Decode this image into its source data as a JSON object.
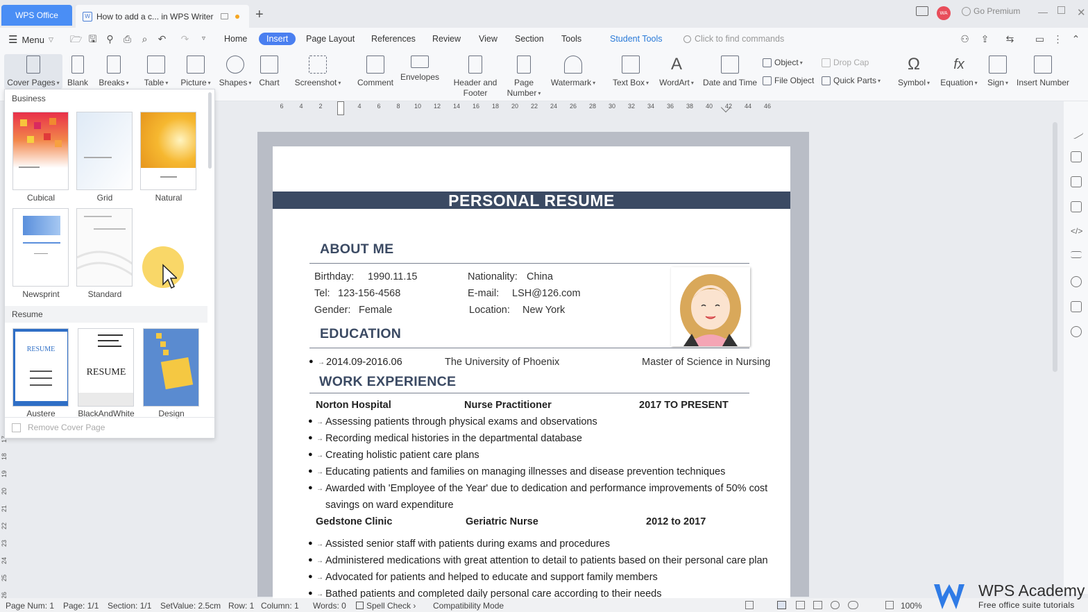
{
  "titlebar": {
    "app_tab": "WPS Office",
    "doc_tab": "How to add a c... in WPS Writer",
    "new_tab": "+",
    "go_premium": "Go Premium",
    "avatar_text": "WA"
  },
  "menubar": {
    "menu_label": "Menu",
    "tabs": [
      "Home",
      "Insert",
      "Page Layout",
      "References",
      "Review",
      "View",
      "Section",
      "Tools"
    ],
    "active_tab": "Insert",
    "student_tools": "Student Tools",
    "find_placeholder": "Click to find commands"
  },
  "ribbon": {
    "cover_pages": "Cover Pages",
    "blank": "Blank",
    "breaks": "Breaks",
    "table": "Table",
    "picture": "Picture",
    "shapes": "Shapes",
    "chart": "Chart",
    "screenshot": "Screenshot",
    "comment": "Comment",
    "envelopes": "Envelopes",
    "header_footer_1": "Header and",
    "header_footer_2": "Footer",
    "page_number_1": "Page",
    "page_number_2": "Number",
    "watermark": "Watermark",
    "text_box": "Text Box",
    "wordart": "WordArt",
    "date_time": "Date and Time",
    "object": "Object",
    "file_object": "File Object",
    "drop_cap": "Drop Cap",
    "quick_parts": "Quick Parts",
    "symbol": "Symbol",
    "equation": "Equation",
    "sign": "Sign",
    "insert_number": "Insert Number"
  },
  "ruler": {
    "ticks": [
      "6",
      "4",
      "2",
      "2",
      "4",
      "6",
      "8",
      "10",
      "12",
      "14",
      "16",
      "18",
      "20",
      "22",
      "24",
      "26",
      "28",
      "30",
      "32",
      "34",
      "36",
      "38",
      "40",
      "42",
      "44",
      "46"
    ],
    "vticks": [
      "17",
      "18",
      "19",
      "20",
      "21",
      "22",
      "23",
      "24",
      "25",
      "26"
    ]
  },
  "cover_panel": {
    "category_business": "Business",
    "business_items": [
      "Cubical",
      "Grid",
      "Natural",
      "Newsprint",
      "Standard"
    ],
    "category_resume": "Resume",
    "resume_items": [
      "Austere",
      "BlackAndWhite",
      "Design"
    ],
    "remove": "Remove Cover Page",
    "thumb_text_resume": "RESUME"
  },
  "document": {
    "title": "PERSONAL RESUME",
    "about_me": "ABOUT ME",
    "birthday_label": "Birthday:",
    "birthday": "1990.11.15",
    "nationality_label": "Nationality:",
    "nationality": "China",
    "tel_label": "Tel:",
    "tel": "123-156-4568",
    "email_label": "E-mail:",
    "email": "LSH@126.com",
    "gender_label": "Gender:",
    "gender": "Female",
    "location_label": "Location:",
    "location": "New York",
    "education": "EDUCATION",
    "edu_dates": "2014.09-2016.06",
    "edu_school": "The University of Phoenix",
    "edu_degree": "Master of Science in Nursing",
    "work_experience": "WORK EXPERIENCE",
    "job1_company": "Norton Hospital",
    "job1_title": "Nurse Practitioner",
    "job1_dates": "2017 TO PRESENT",
    "job1_bullets": [
      "Assessing patients through physical exams and observations",
      "Recording medical histories in the departmental database",
      "Creating holistic patient care plans",
      "Educating patients and families on managing illnesses and disease prevention techniques",
      "Awarded with 'Employee of the Year' due to dedication and performance improvements of 50% cost",
      "savings on ward expenditure"
    ],
    "job2_company": "Gedstone Clinic",
    "job2_title": "Geriatric Nurse",
    "job2_dates": "2012 to 2017",
    "job2_bullets": [
      "Assisted senior staff with patients during exams and procedures",
      "Administered medications with great attention to detail to patients based on their personal care plan",
      "Advocated for patients and helped to educate and support family members",
      "Bathed patients and completed daily personal care according to their needs"
    ]
  },
  "statusbar": {
    "page_num": "Page Num: 1",
    "page": "Page: 1/1",
    "section": "Section: 1/1",
    "setvalue": "SetValue: 2.5cm",
    "row": "Row: 1",
    "column": "Column: 1",
    "words": "Words: 0",
    "spell_check": "Spell Check",
    "compat": "Compatibility Mode",
    "zoom": "100%"
  },
  "watermark": {
    "brand": "WPS Academy",
    "tagline": "Free office suite tutorials"
  },
  "colors": {
    "accent": "#4a7ff0",
    "banner": "#3b4a63",
    "cursor_highlight": "#f7c935"
  }
}
